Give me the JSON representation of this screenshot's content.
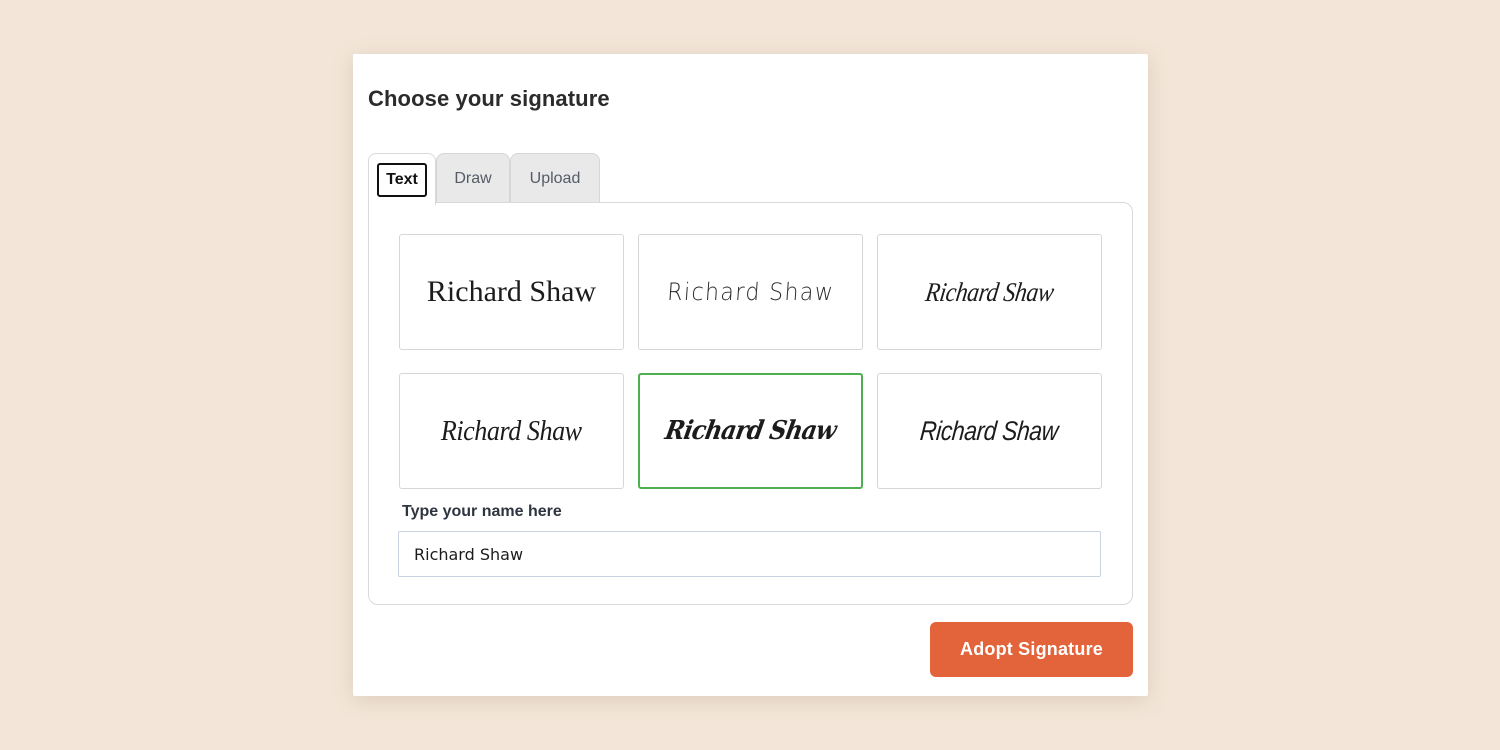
{
  "dialog": {
    "title": "Choose your signature"
  },
  "tabs": [
    {
      "label": "Text",
      "active": true
    },
    {
      "label": "Draw",
      "active": false
    },
    {
      "label": "Upload",
      "active": false
    }
  ],
  "signature_options": [
    {
      "text": "Richard Shaw",
      "selected": false
    },
    {
      "text": "Richard Shaw",
      "selected": false
    },
    {
      "text": "Richard Shaw",
      "selected": false
    },
    {
      "text": "Richard Shaw",
      "selected": false
    },
    {
      "text": "Richard Shaw",
      "selected": true
    },
    {
      "text": "Richard Shaw",
      "selected": false
    }
  ],
  "name_field": {
    "label": "Type your name here",
    "value": "Richard Shaw"
  },
  "actions": {
    "adopt_label": "Adopt Signature"
  },
  "colors": {
    "background": "#f3e6d8",
    "accent_button": "#e3643a",
    "selected_border": "#4caf50"
  }
}
